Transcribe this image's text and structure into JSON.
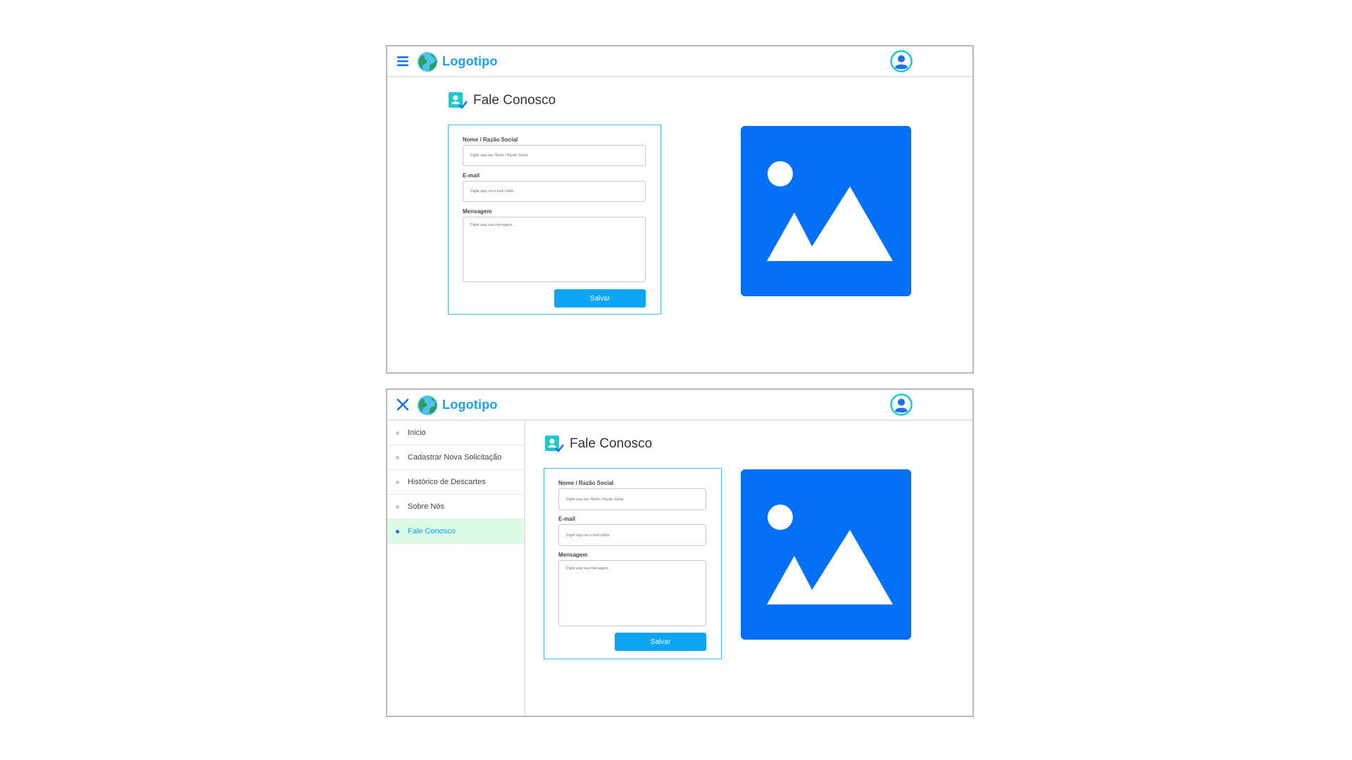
{
  "logo_text": "Logotipo",
  "colors": {
    "accent": "#1aa3e8",
    "button": "#0ea5f5",
    "placeholder_image": "#0470f5",
    "active_bg": "#dcfbe7",
    "card_border": "#4db8f0"
  },
  "icons": {
    "menu": "hamburger-menu-icon",
    "close": "close-icon",
    "logo": "globe-icon",
    "user": "user-avatar-icon",
    "contact": "contact-book-icon",
    "image": "image-placeholder-icon"
  },
  "page": {
    "title": "Fale Conosco"
  },
  "form": {
    "name_label": "Nome / Razão Social",
    "name_placeholder": "Digite aqui seu Nome / Razão Social",
    "email_label": "E-mail",
    "email_placeholder": "Digite aqui um e-mail válido",
    "message_label": "Mensagem",
    "message_placeholder": "Digite aqui sua mensagem...",
    "save_label": "Salvar"
  },
  "sidebar": {
    "items": [
      {
        "label": "Inicio",
        "active": false
      },
      {
        "label": "Cadastrar Nova Solicitação",
        "active": false
      },
      {
        "label": "Histórico de Descartes",
        "active": false
      },
      {
        "label": "Sobre Nós",
        "active": false
      },
      {
        "label": "Fale Conosco",
        "active": true
      }
    ]
  }
}
